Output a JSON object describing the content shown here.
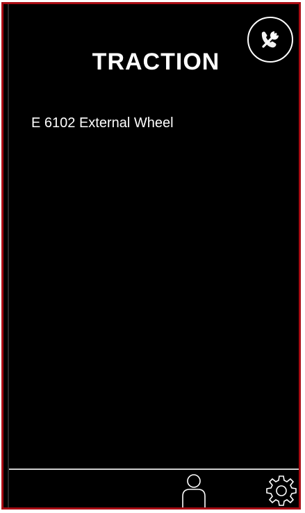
{
  "header": {
    "title": "TRACTION"
  },
  "list": {
    "items": [
      {
        "label": "E 6102 External Wheel"
      }
    ]
  },
  "icons": {
    "support": "phone-wrench-icon",
    "profile": "person-icon",
    "settings": "gear-icon"
  },
  "colors": {
    "frame_border": "#a80d14",
    "background": "#000000",
    "foreground": "#ffffff",
    "divider": "#cfcfcf"
  }
}
